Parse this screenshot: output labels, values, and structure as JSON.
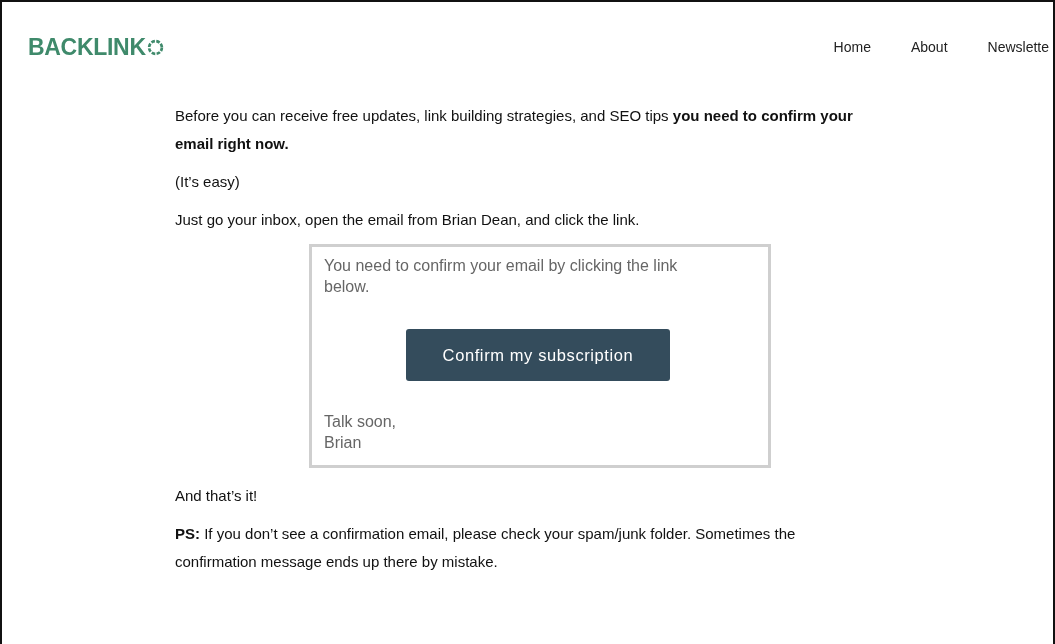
{
  "header": {
    "logo": "BACKLINK",
    "nav": [
      "Home",
      "About",
      "Newslette"
    ]
  },
  "intro": [
    "Before you can receive free updates, link building strategies, and SEO tips **you need to confirm your email right now.**",
    "(It’s easy)",
    "Just go your inbox, open the email from Brian Dean, and click the link."
  ],
  "email_preview": {
    "message": "You need to confirm your email by clicking the link below.",
    "button": "Confirm my subscription",
    "signoff": [
      "Talk soon,",
      "Brian"
    ]
  },
  "outro": [
    "And that’s it!",
    "**PS:** If you don’t see a confirmation email, please check your spam/junk folder. Sometimes the confirmation message ends up there by mistake."
  ]
}
